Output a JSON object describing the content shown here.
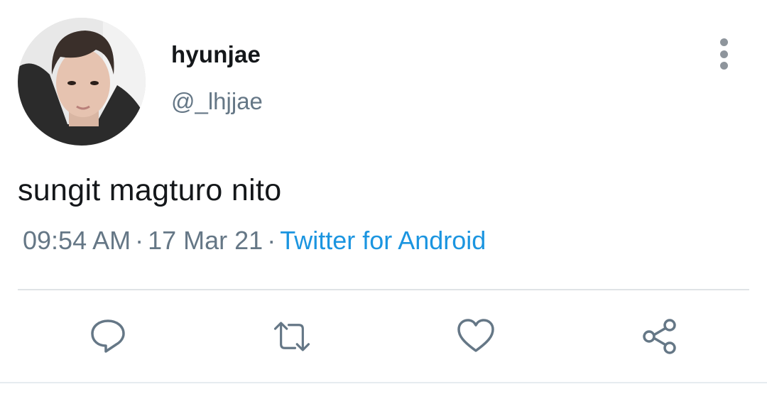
{
  "tweet": {
    "display_name": "hyunjae",
    "handle": "@_lhjjae",
    "text": "sungit magturo nito",
    "time": "09:54 AM",
    "date": "17 Mar 21",
    "separator": "·",
    "source": "Twitter for Android"
  },
  "icons": {
    "menu": "more-vertical-icon",
    "reply": "reply-icon",
    "retweet": "retweet-icon",
    "like": "heart-icon",
    "share": "share-icon"
  },
  "colors": {
    "text": "#14171a",
    "secondary": "#657786",
    "link": "#1b95e0",
    "icon": "#657786"
  }
}
